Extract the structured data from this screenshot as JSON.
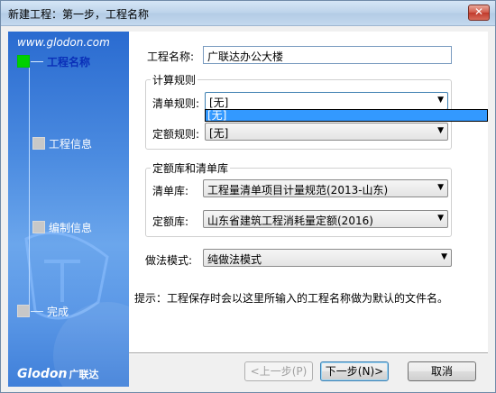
{
  "window": {
    "title": "新建工程：第一步，工程名称",
    "close_glyph": "✕"
  },
  "sidebar": {
    "url": "www.glodon.com",
    "steps": [
      {
        "label": "工程名称",
        "active": true
      },
      {
        "label": "工程信息",
        "active": false
      },
      {
        "label": "编制信息",
        "active": false
      },
      {
        "label": "完成",
        "active": false
      }
    ],
    "logo_text": "Glodon",
    "logo_cn": "广联达"
  },
  "form": {
    "project_name_label": "工程名称:",
    "project_name_value": "广联达办公大楼",
    "calc_rules_group": "计算规则",
    "bill_rule_label": "清单规则:",
    "bill_rule_value": "[无]",
    "quota_rule_label": "定额规则:",
    "quota_rule_value": "[无]",
    "library_group": "定额库和清单库",
    "bill_lib_label": "清单库:",
    "bill_lib_value": "工程量清单项目计量规范(2013-山东)",
    "quota_lib_label": "定额库:",
    "quota_lib_value": "山东省建筑工程消耗量定额(2016)",
    "method_label": "做法模式:",
    "method_value": "纯做法模式",
    "hint": "提示：工程保存时会以这里所输入的工程名称做为默认的文件名。"
  },
  "dropdown": {
    "options": [
      "[无]"
    ],
    "highlighted": "[无]"
  },
  "buttons": {
    "prev": "<上一步(P)",
    "next": "下一步(N)>",
    "cancel": "取消"
  },
  "icons": {
    "combo_arrow": "▼"
  },
  "colors": {
    "sidebar_top": "#2a6bd0",
    "active_step": "#00d000",
    "selection": "#3399ff"
  }
}
